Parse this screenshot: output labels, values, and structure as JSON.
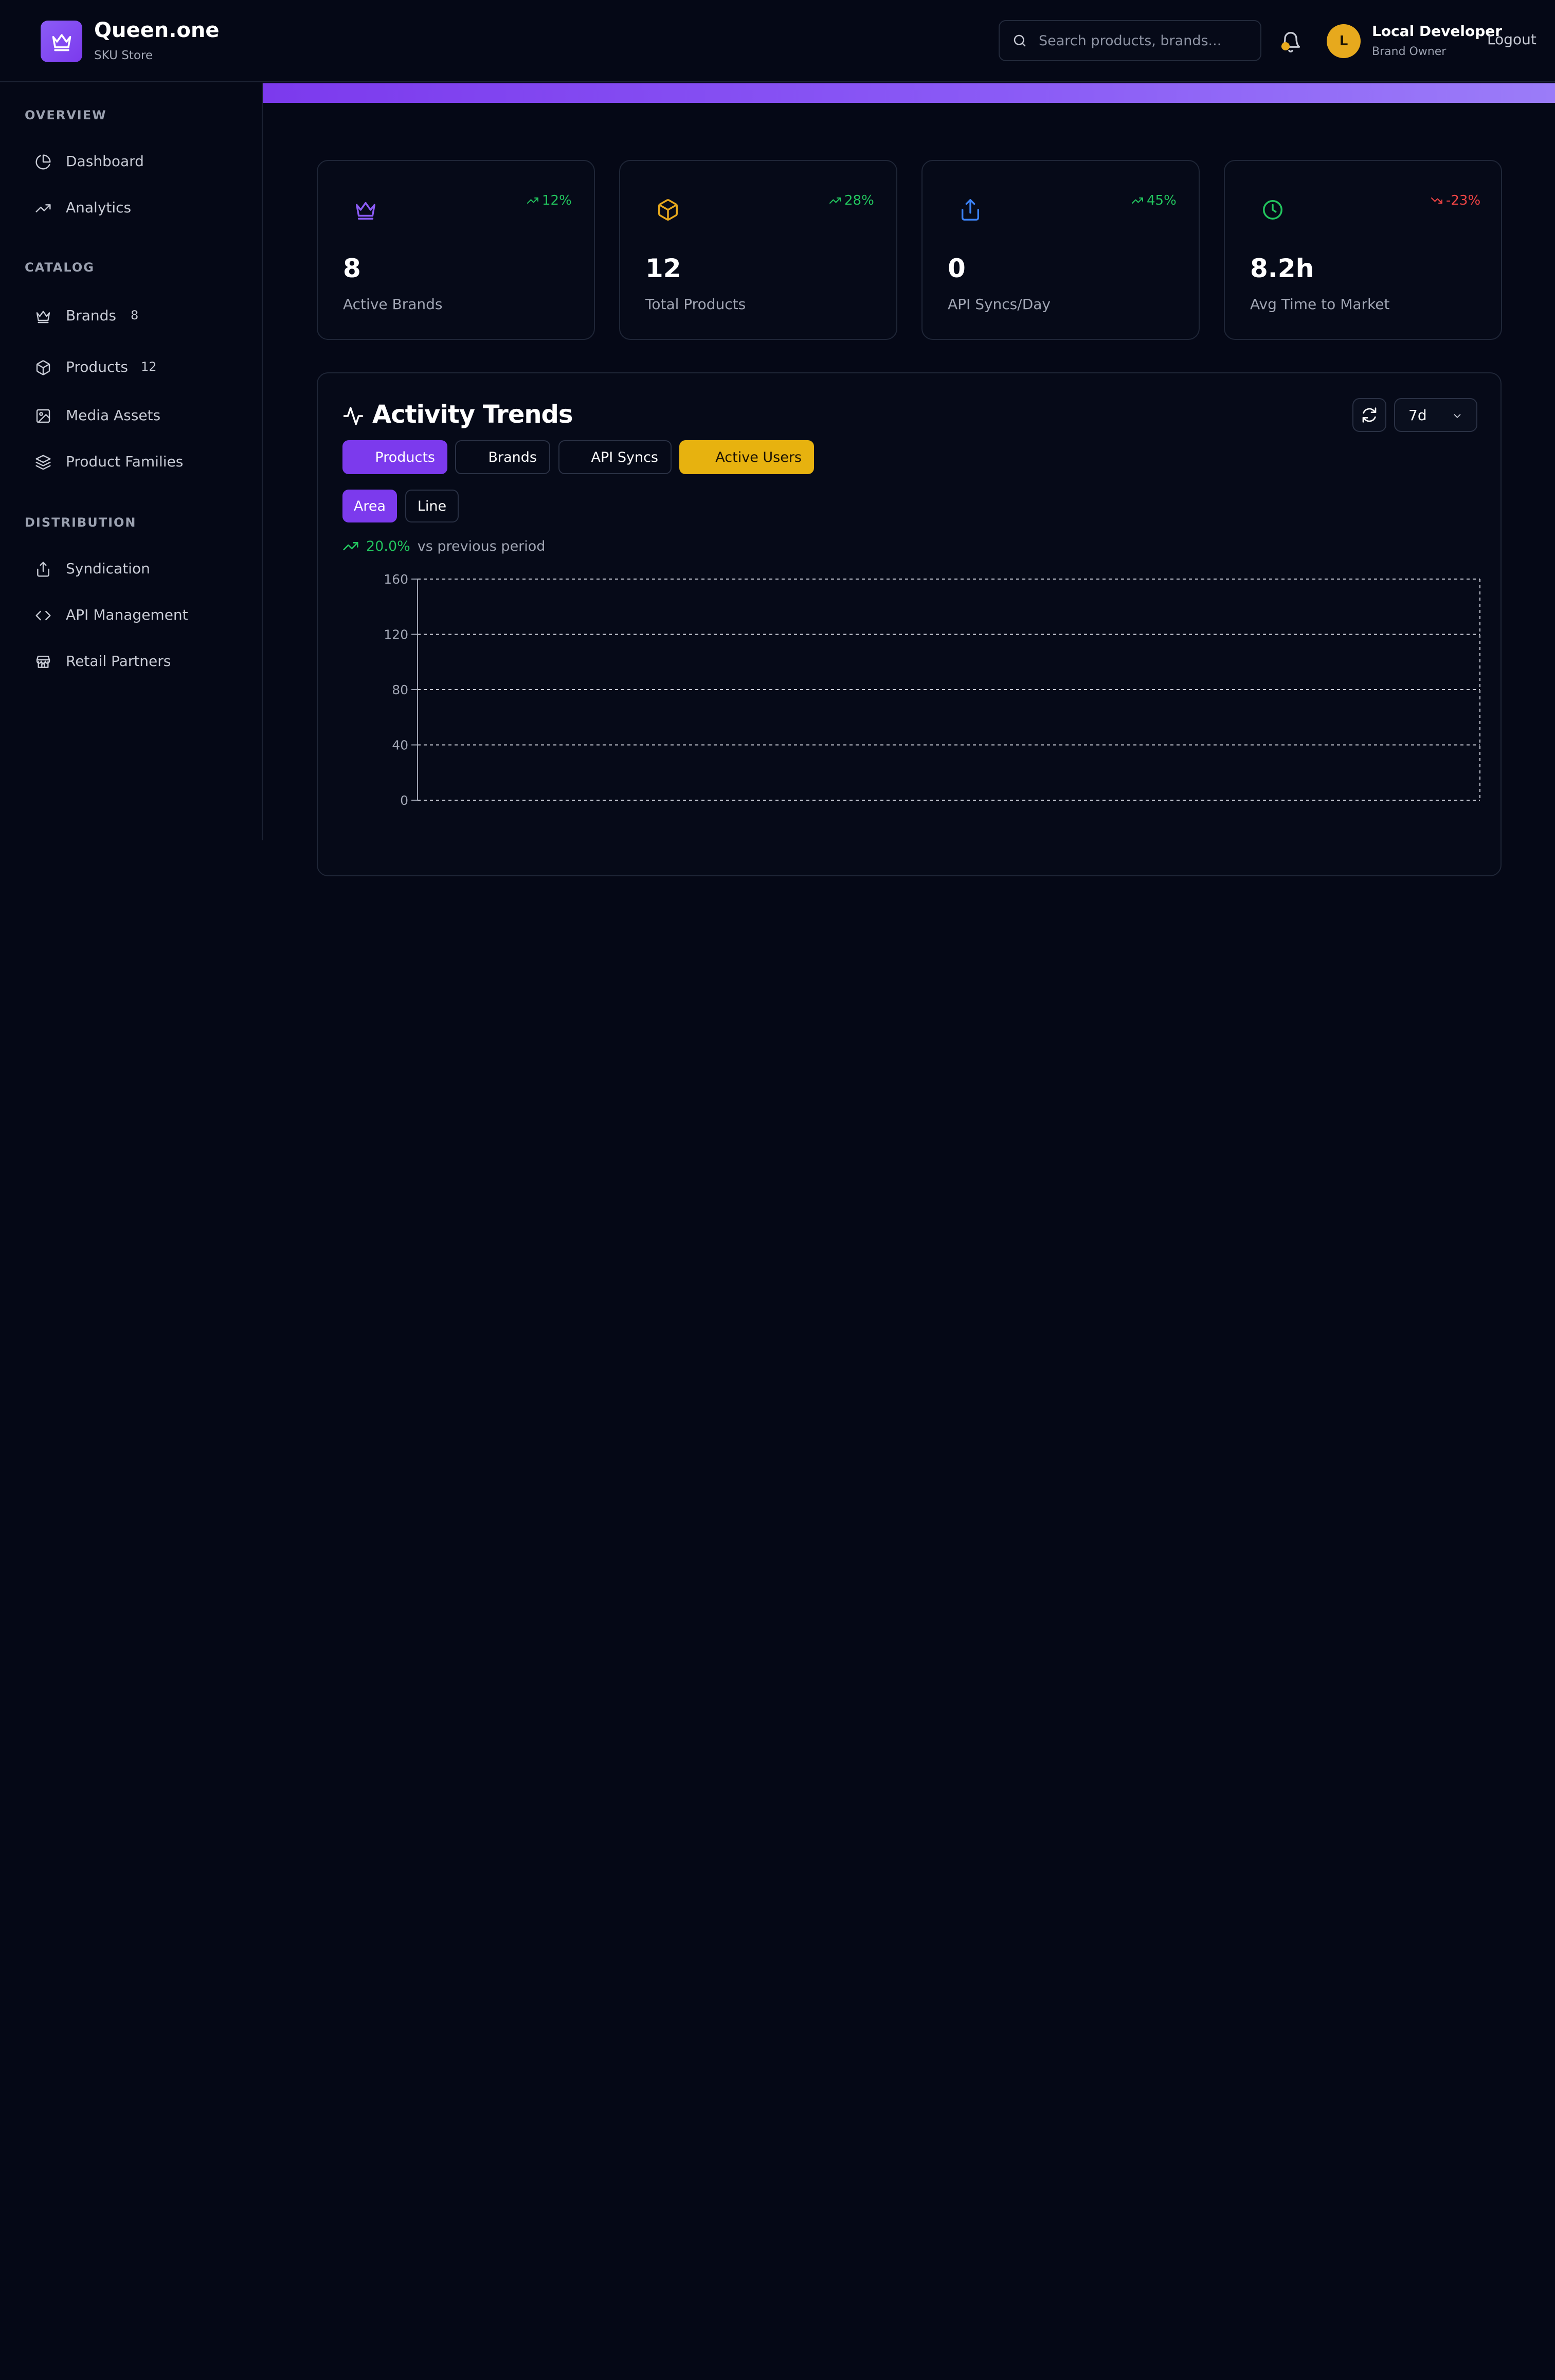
{
  "app": {
    "name": "Queen.one",
    "subtitle": "SKU Store"
  },
  "header": {
    "search_placeholder": "Search products, brands...",
    "user_initial": "L",
    "user_name": "Local Developer",
    "user_role": "Brand Owner",
    "logout_label": "Logout"
  },
  "sidebar": {
    "sections": [
      {
        "title": "OVERVIEW"
      },
      {
        "title": "CATALOG"
      },
      {
        "title": "DISTRIBUTION"
      }
    ],
    "items": [
      {
        "label": "Dashboard",
        "icon": "pie-chart-icon"
      },
      {
        "label": "Analytics",
        "icon": "trending-up-icon"
      },
      {
        "label": "Brands",
        "icon": "crown-icon",
        "count": "8"
      },
      {
        "label": "Products",
        "icon": "box-icon",
        "count": "12"
      },
      {
        "label": "Media Assets",
        "icon": "image-icon"
      },
      {
        "label": "Product Families",
        "icon": "layers-icon"
      },
      {
        "label": "Syndication",
        "icon": "share-icon"
      },
      {
        "label": "API Management",
        "icon": "code-icon"
      },
      {
        "label": "Retail Partners",
        "icon": "store-icon"
      }
    ]
  },
  "stats": [
    {
      "value": "8",
      "label": "Active Brands",
      "trend": "12%",
      "trend_dir": "up",
      "icon": "crown-icon",
      "icon_color": "#8b5cf6"
    },
    {
      "value": "12",
      "label": "Total Products",
      "trend": "28%",
      "trend_dir": "up",
      "icon": "box-icon",
      "icon_color": "#e7a91d"
    },
    {
      "value": "0",
      "label": "API Syncs/Day",
      "trend": "45%",
      "trend_dir": "up",
      "icon": "share-icon",
      "icon_color": "#3b82f6"
    },
    {
      "value": "8.2h",
      "label": "Avg Time to Market",
      "trend": "-23%",
      "trend_dir": "down",
      "icon": "clock-icon",
      "icon_color": "#22c55e"
    }
  ],
  "activity": {
    "title": "Activity Trends",
    "range": "7d",
    "metrics": [
      {
        "label": "Products",
        "state": "active-purple"
      },
      {
        "label": "Brands",
        "state": "inactive"
      },
      {
        "label": "API Syncs",
        "state": "inactive"
      },
      {
        "label": "Active Users",
        "state": "active-yellow"
      }
    ],
    "chart_types": [
      {
        "label": "Area",
        "active": true
      },
      {
        "label": "Line",
        "active": false
      }
    ],
    "change_pct": "20.0%",
    "change_text": "vs previous period"
  },
  "colors": {
    "accent": "#7c3aed",
    "yellow": "#e7b20f",
    "up": "#22c55e",
    "down": "#ef4444",
    "background": "#050816"
  },
  "chart_data": {
    "type": "area",
    "series": [],
    "y_ticks": [
      "0",
      "40",
      "80",
      "120",
      "160"
    ],
    "ylim": [
      0,
      160
    ],
    "grid": true
  }
}
